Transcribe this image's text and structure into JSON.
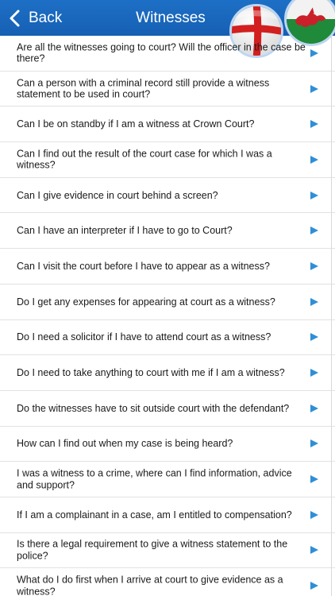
{
  "navbar": {
    "back_label": "Back",
    "title": "Witnesses",
    "background_color": "#1766b8",
    "flags": [
      "england-flag-icon",
      "wales-flag-icon"
    ]
  },
  "list": {
    "arrow_color": "#2f8fd6",
    "items": [
      {
        "label": "Are all the witnesses going to court? Will the officer in the case be there?"
      },
      {
        "label": "Can a person with a criminal record still provide a witness statement to be used in court?"
      },
      {
        "label": "Can I be on standby if I am a witness at Crown Court?"
      },
      {
        "label": "Can I find out the result of the court case for which I was a witness?"
      },
      {
        "label": "Can I give evidence in court behind a screen?"
      },
      {
        "label": "Can I have an interpreter if I have to go to Court?"
      },
      {
        "label": "Can I visit the court before I have to appear as a witness?"
      },
      {
        "label": "Do I get any expenses for appearing at court as a witness?"
      },
      {
        "label": "Do I need a solicitor if I have to attend court as a witness?"
      },
      {
        "label": "Do I need to take anything to court with me if I am a witness?"
      },
      {
        "label": "Do the witnesses have to sit outside court with the defendant?"
      },
      {
        "label": "How can I find out when my case is being heard?"
      },
      {
        "label": "I was a witness to a crime, where can I find information, advice and support?"
      },
      {
        "label": "If I am a complainant in a case, am I entitled to compensation?"
      },
      {
        "label": "Is there a legal requirement to give a witness statement to the police?"
      },
      {
        "label": "What do I do first when I arrive at court to give evidence as a witness?"
      }
    ]
  }
}
